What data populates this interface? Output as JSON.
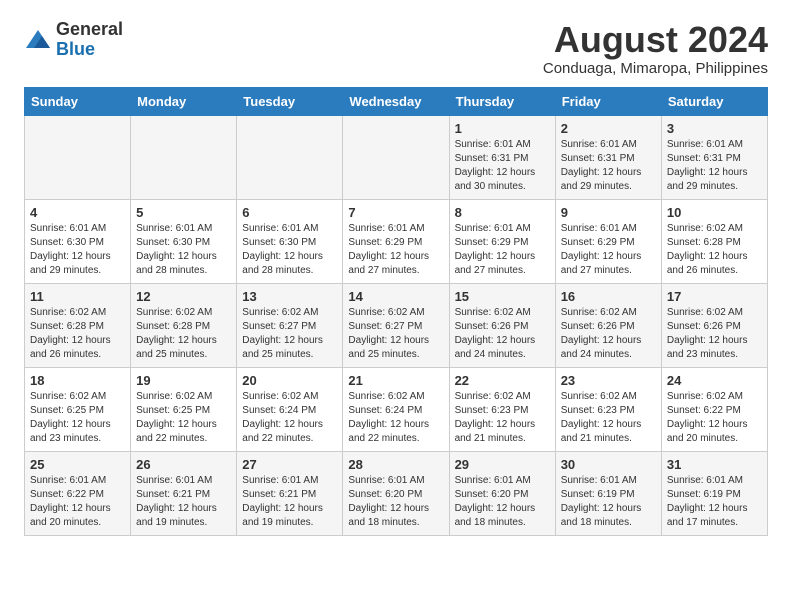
{
  "header": {
    "logo_general": "General",
    "logo_blue": "Blue",
    "month_year": "August 2024",
    "location": "Conduaga, Mimaropa, Philippines"
  },
  "days_of_week": [
    "Sunday",
    "Monday",
    "Tuesday",
    "Wednesday",
    "Thursday",
    "Friday",
    "Saturday"
  ],
  "weeks": [
    [
      {
        "day": "",
        "info": ""
      },
      {
        "day": "",
        "info": ""
      },
      {
        "day": "",
        "info": ""
      },
      {
        "day": "",
        "info": ""
      },
      {
        "day": "1",
        "info": "Sunrise: 6:01 AM\nSunset: 6:31 PM\nDaylight: 12 hours\nand 30 minutes."
      },
      {
        "day": "2",
        "info": "Sunrise: 6:01 AM\nSunset: 6:31 PM\nDaylight: 12 hours\nand 29 minutes."
      },
      {
        "day": "3",
        "info": "Sunrise: 6:01 AM\nSunset: 6:31 PM\nDaylight: 12 hours\nand 29 minutes."
      }
    ],
    [
      {
        "day": "4",
        "info": "Sunrise: 6:01 AM\nSunset: 6:30 PM\nDaylight: 12 hours\nand 29 minutes."
      },
      {
        "day": "5",
        "info": "Sunrise: 6:01 AM\nSunset: 6:30 PM\nDaylight: 12 hours\nand 28 minutes."
      },
      {
        "day": "6",
        "info": "Sunrise: 6:01 AM\nSunset: 6:30 PM\nDaylight: 12 hours\nand 28 minutes."
      },
      {
        "day": "7",
        "info": "Sunrise: 6:01 AM\nSunset: 6:29 PM\nDaylight: 12 hours\nand 27 minutes."
      },
      {
        "day": "8",
        "info": "Sunrise: 6:01 AM\nSunset: 6:29 PM\nDaylight: 12 hours\nand 27 minutes."
      },
      {
        "day": "9",
        "info": "Sunrise: 6:01 AM\nSunset: 6:29 PM\nDaylight: 12 hours\nand 27 minutes."
      },
      {
        "day": "10",
        "info": "Sunrise: 6:02 AM\nSunset: 6:28 PM\nDaylight: 12 hours\nand 26 minutes."
      }
    ],
    [
      {
        "day": "11",
        "info": "Sunrise: 6:02 AM\nSunset: 6:28 PM\nDaylight: 12 hours\nand 26 minutes."
      },
      {
        "day": "12",
        "info": "Sunrise: 6:02 AM\nSunset: 6:28 PM\nDaylight: 12 hours\nand 25 minutes."
      },
      {
        "day": "13",
        "info": "Sunrise: 6:02 AM\nSunset: 6:27 PM\nDaylight: 12 hours\nand 25 minutes."
      },
      {
        "day": "14",
        "info": "Sunrise: 6:02 AM\nSunset: 6:27 PM\nDaylight: 12 hours\nand 25 minutes."
      },
      {
        "day": "15",
        "info": "Sunrise: 6:02 AM\nSunset: 6:26 PM\nDaylight: 12 hours\nand 24 minutes."
      },
      {
        "day": "16",
        "info": "Sunrise: 6:02 AM\nSunset: 6:26 PM\nDaylight: 12 hours\nand 24 minutes."
      },
      {
        "day": "17",
        "info": "Sunrise: 6:02 AM\nSunset: 6:26 PM\nDaylight: 12 hours\nand 23 minutes."
      }
    ],
    [
      {
        "day": "18",
        "info": "Sunrise: 6:02 AM\nSunset: 6:25 PM\nDaylight: 12 hours\nand 23 minutes."
      },
      {
        "day": "19",
        "info": "Sunrise: 6:02 AM\nSunset: 6:25 PM\nDaylight: 12 hours\nand 22 minutes."
      },
      {
        "day": "20",
        "info": "Sunrise: 6:02 AM\nSunset: 6:24 PM\nDaylight: 12 hours\nand 22 minutes."
      },
      {
        "day": "21",
        "info": "Sunrise: 6:02 AM\nSunset: 6:24 PM\nDaylight: 12 hours\nand 22 minutes."
      },
      {
        "day": "22",
        "info": "Sunrise: 6:02 AM\nSunset: 6:23 PM\nDaylight: 12 hours\nand 21 minutes."
      },
      {
        "day": "23",
        "info": "Sunrise: 6:02 AM\nSunset: 6:23 PM\nDaylight: 12 hours\nand 21 minutes."
      },
      {
        "day": "24",
        "info": "Sunrise: 6:02 AM\nSunset: 6:22 PM\nDaylight: 12 hours\nand 20 minutes."
      }
    ],
    [
      {
        "day": "25",
        "info": "Sunrise: 6:01 AM\nSunset: 6:22 PM\nDaylight: 12 hours\nand 20 minutes."
      },
      {
        "day": "26",
        "info": "Sunrise: 6:01 AM\nSunset: 6:21 PM\nDaylight: 12 hours\nand 19 minutes."
      },
      {
        "day": "27",
        "info": "Sunrise: 6:01 AM\nSunset: 6:21 PM\nDaylight: 12 hours\nand 19 minutes."
      },
      {
        "day": "28",
        "info": "Sunrise: 6:01 AM\nSunset: 6:20 PM\nDaylight: 12 hours\nand 18 minutes."
      },
      {
        "day": "29",
        "info": "Sunrise: 6:01 AM\nSunset: 6:20 PM\nDaylight: 12 hours\nand 18 minutes."
      },
      {
        "day": "30",
        "info": "Sunrise: 6:01 AM\nSunset: 6:19 PM\nDaylight: 12 hours\nand 18 minutes."
      },
      {
        "day": "31",
        "info": "Sunrise: 6:01 AM\nSunset: 6:19 PM\nDaylight: 12 hours\nand 17 minutes."
      }
    ]
  ]
}
